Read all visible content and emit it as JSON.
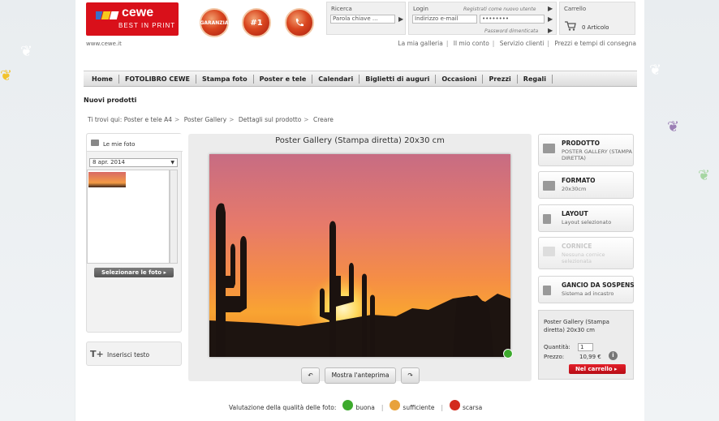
{
  "brand": {
    "name": "cewe",
    "tagline": "BEST IN PRINT",
    "site_url": "www.cewe.it"
  },
  "badges": [
    "GARANZIA",
    "#1",
    ""
  ],
  "search": {
    "title": "Ricerca",
    "value": "Parola chiave ..."
  },
  "login": {
    "title": "Login",
    "note_register": "Registrati come nuovo utente",
    "email_value": "Indirizzo e-mail",
    "password_value": "••••••••",
    "note_forgot": "Password dimenticata"
  },
  "cart_header": {
    "title": "Carrello",
    "count": "0 Articolo"
  },
  "top_links": [
    "La mia galleria",
    "Il mio conto",
    "Servizio clienti",
    "Prezzi e tempi di consegna"
  ],
  "nav": [
    "Home",
    "FOTOLIBRO CEWE",
    "Stampa foto",
    "Poster e tele",
    "Calendari",
    "Biglietti di auguri",
    "Occasioni",
    "Prezzi",
    "Regali"
  ],
  "section_title": "Nuovi prodotti",
  "breadcrumb": [
    "Ti trovi qui:",
    "Poster e tele A4",
    "Poster Gallery",
    "Dettagli sul prodotto",
    "Creare"
  ],
  "left_panel": {
    "header": "Le mie foto",
    "date_select": "8 apr. 2014",
    "select_photos_button": "Selezionare le foto",
    "insert_text": "Inserisci testo"
  },
  "canvas": {
    "title": "Poster Gallery (Stampa diretta) 20x30 cm",
    "preview_button": "Mostra l'anteprima"
  },
  "options": [
    {
      "title": "PRODOTTO",
      "sub": "POSTER GALLERY (STAMPA DIRETTA)",
      "disabled": false
    },
    {
      "title": "FORMATO",
      "sub": "20x30cm",
      "disabled": false
    },
    {
      "title": "LAYOUT",
      "sub": "Layout selezionato",
      "disabled": false
    },
    {
      "title": "CORNICE",
      "sub": "Nessuna cornice selezionata",
      "disabled": true
    },
    {
      "title": "GANCIO DA SOSPENS",
      "sub": "Sistema ad incastro",
      "disabled": false
    }
  ],
  "order": {
    "product": "Poster Gallery (Stampa diretta) 20x30 cm",
    "qty_label": "Quantità:",
    "qty_value": "1",
    "price_label": "Prezzo:",
    "price_value": "10,99 €",
    "add_to_cart": "Nel carrello"
  },
  "quality": {
    "label": "Valutazione della qualità delle foto:",
    "good": "buona",
    "sufficient": "sufficiente",
    "poor": "scarsa",
    "colors": {
      "good": "#3daa2d",
      "sufficient": "#e8a23b",
      "poor": "#d32b1c"
    }
  },
  "colors": {
    "brand_red": "#d9101a"
  }
}
